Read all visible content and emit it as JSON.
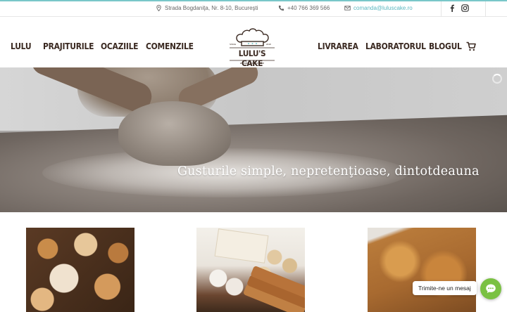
{
  "topbar": {
    "address": "Strada Bogdaniţa, Nr. 8-10, Bucureşti",
    "phone": "+40 766 369 566",
    "email": "comanda@luluscake.ro",
    "icons": [
      "map-pin-icon",
      "phone-icon",
      "envelope-icon",
      "facebook-icon",
      "instagram-icon"
    ]
  },
  "nav": {
    "left": [
      "LULU",
      "PRAJITURILE",
      "OCAZIILE",
      "COMENZILE"
    ],
    "right": [
      "LIVRAREA",
      "LABORATORUL",
      "BLOGUL"
    ],
    "logo": {
      "since": "SINCE",
      "year": "2018",
      "name": "LULU'S CAKE",
      "slogan": "we bake for your sake"
    }
  },
  "hero": {
    "tagline": "Gusturile simple, nepretenţioase, dintotdeauna"
  },
  "chat": {
    "label": "Trimite-ne un mesaj"
  },
  "colors": {
    "accent": "#79c7c9",
    "nav_text": "#3b2a22",
    "chat_green": "#7ac143"
  }
}
